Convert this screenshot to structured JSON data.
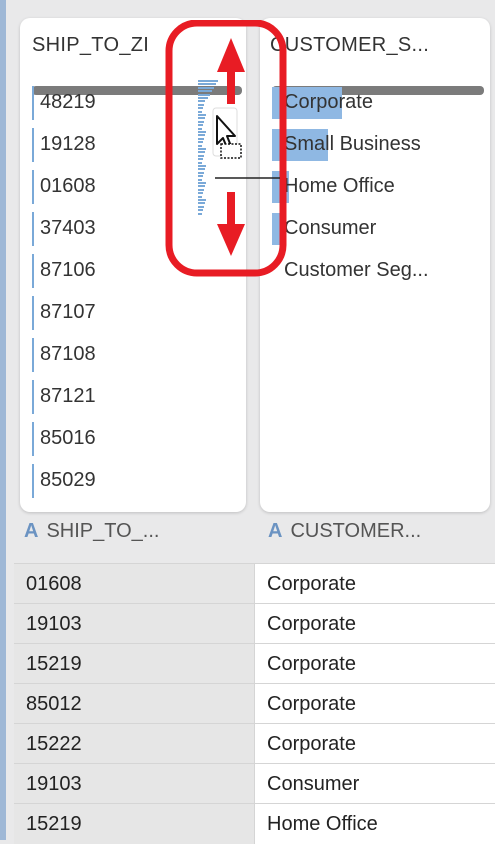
{
  "zip_card": {
    "title": "SHIP_TO_ZI",
    "items": [
      "48219",
      "19128",
      "01608",
      "37403",
      "87106",
      "87107",
      "87108",
      "87121",
      "85016",
      "85029"
    ]
  },
  "segment_card": {
    "title": "CUSTOMER_S...",
    "items": [
      {
        "label": "Corporate",
        "share": 0.58
      },
      {
        "label": "Small Business",
        "share": 0.47
      },
      {
        "label": "Home Office",
        "share": 0.14
      },
      {
        "label": "Consumer",
        "share": 0.11
      },
      {
        "label": "Customer Seg...",
        "share": 0
      }
    ]
  },
  "columns": {
    "left_icon": "A",
    "left_label": "SHIP_TO_...",
    "right_icon": "A",
    "right_label": "CUSTOMER..."
  },
  "rows": [
    [
      "01608",
      "Corporate"
    ],
    [
      "19103",
      "Corporate"
    ],
    [
      "15219",
      "Corporate"
    ],
    [
      "85012",
      "Corporate"
    ],
    [
      "15222",
      "Corporate"
    ],
    [
      "19103",
      "Consumer"
    ],
    [
      "15219",
      "Home Office"
    ]
  ],
  "colors": {
    "accent_bar": "#8fb8e3",
    "annotation": "#e81c24"
  }
}
